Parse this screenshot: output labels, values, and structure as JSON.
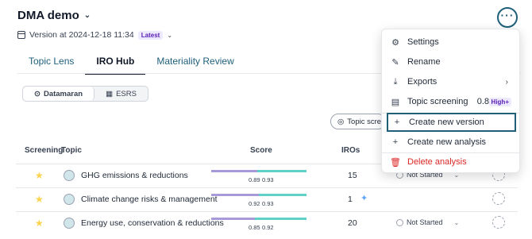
{
  "header": {
    "title": "DMA demo",
    "version_text": "Version at 2024-12-18 11:34",
    "latest_badge": "Latest",
    "more_label": "···"
  },
  "tabs": [
    {
      "label": "Topic Lens"
    },
    {
      "label": "IRO Hub"
    },
    {
      "label": "Materiality Review"
    }
  ],
  "toggle": {
    "options": [
      {
        "label": "Datamaran",
        "icon": "⊙"
      },
      {
        "label": "ESRS",
        "icon": "▦"
      }
    ]
  },
  "topic_pill": {
    "label": "Topic scree"
  },
  "table": {
    "headers": {
      "screening": "Screening",
      "topic": "Topic",
      "score": "Score",
      "iros": "IROs"
    },
    "rows": [
      {
        "topic": "GHG emissions & reductions",
        "score_a": "0.89",
        "score_b": "0.93",
        "iros": "15",
        "status": "Not Started",
        "bar_purple": 0.48
      },
      {
        "topic": "Climate change risks & management",
        "score_a": "0.92",
        "score_b": "0.93",
        "iros": "1",
        "status": "",
        "bar_purple": 0.5
      },
      {
        "topic": "Energy use, conservation & reductions",
        "score_a": "0.85",
        "score_b": "0.92",
        "iros": "20",
        "status": "Not Started",
        "bar_purple": 0.46
      }
    ]
  },
  "menu": {
    "settings": "Settings",
    "rename": "Rename",
    "exports": "Exports",
    "topic_screening": "Topic screening",
    "topic_screening_value": "0.8",
    "topic_screening_badge": "High+",
    "create_version": "Create new version",
    "create_analysis": "Create new analysis",
    "delete_analysis": "Delete analysis"
  },
  "colors": {
    "accent": "#1f5f7a",
    "danger": "#dc2626",
    "purple_bar": "#a89ad8",
    "teal_bar": "#5ed1c8"
  }
}
